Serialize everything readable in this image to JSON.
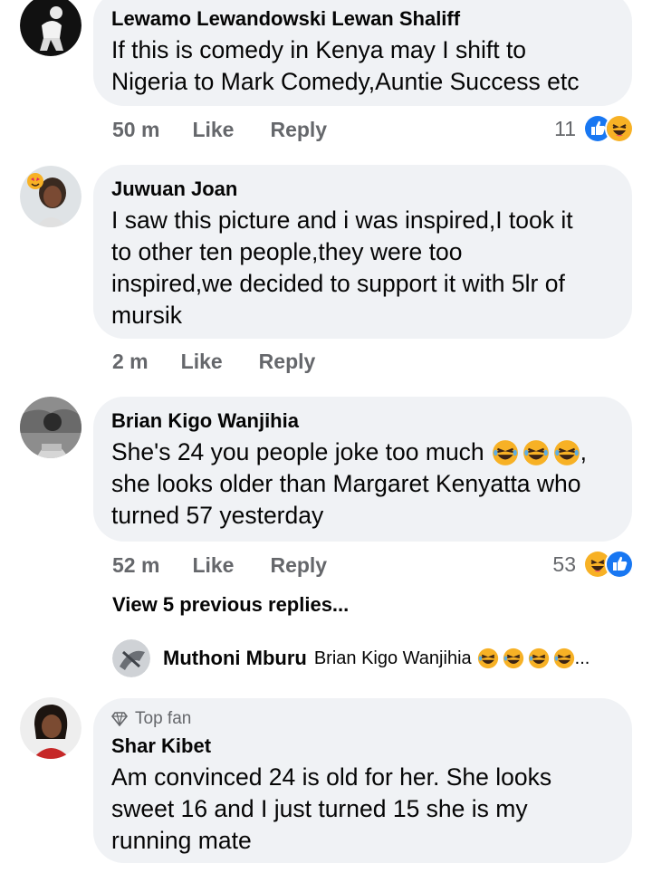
{
  "comments": [
    {
      "author": "Lewamo Lewandowski Lewan Shaliff",
      "lines": [
        "If this is comedy in Kenya may I shift to",
        "Nigeria to Mark Comedy,Auntie Success etc"
      ],
      "time": "50 m",
      "like_label": "Like",
      "reply_label": "Reply",
      "reaction_count": "11",
      "reactions": [
        "like-icon",
        "haha-icon"
      ]
    },
    {
      "author": "Juwuan Joan",
      "lines": [
        "I saw this picture and i was inspired,I took it",
        "to other ten people,they were too",
        "inspired,we decided to support it with 5lr of",
        "mursik"
      ],
      "time": "2 m",
      "like_label": "Like",
      "reply_label": "Reply"
    },
    {
      "author": "Brian Kigo Wanjihia",
      "lines": [
        "She's 24 you people joke too much",
        "she looks older than Margaret Kenyatta who",
        "turned 57 yesterday"
      ],
      "line1_suffix": ",",
      "time": "52 m",
      "like_label": "Like",
      "reply_label": "Reply",
      "reaction_count": "53",
      "reactions": [
        "haha-icon",
        "like-icon"
      ]
    },
    {
      "badge": "Top fan",
      "author": "Shar Kibet",
      "lines": [
        "Am convinced 24 is old for her. She looks",
        "sweet 16 and I just turned 15 she is my",
        "running mate"
      ]
    }
  ],
  "view_previous": "View 5 previous replies...",
  "reply_preview": {
    "author": "Muthoni Mburu",
    "text": "Brian Kigo Wanjihia",
    "ellipsis": "..."
  },
  "colors": {
    "bubble": "#f0f2f5",
    "meta": "#65676b",
    "like_blue": "#1877f2",
    "haha_yellow": "#f7b125"
  }
}
